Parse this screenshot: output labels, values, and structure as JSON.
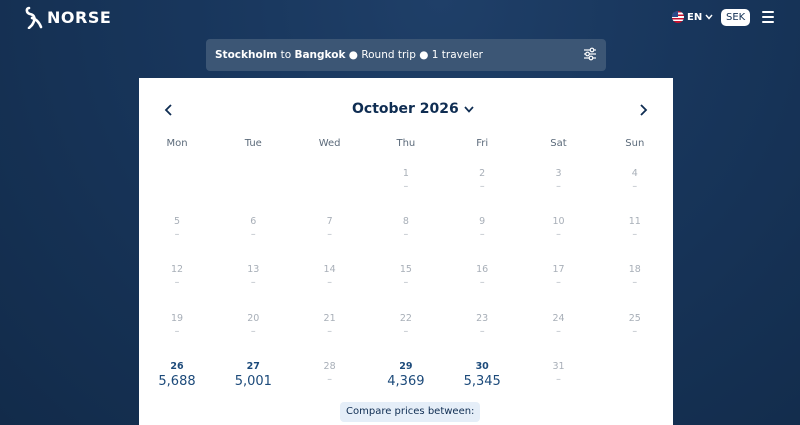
{
  "brand": {
    "name": "NORSE"
  },
  "header": {
    "language": "EN",
    "currency": "SEK"
  },
  "search": {
    "origin": "Stockholm",
    "to_word": "to",
    "destination": "Bangkok",
    "trip_type": "Round trip",
    "travelers": "1 traveler",
    "bullet": "●"
  },
  "calendar": {
    "month_label": "October 2026",
    "weekdays": [
      "Mon",
      "Tue",
      "Wed",
      "Thu",
      "Fri",
      "Sat",
      "Sun"
    ],
    "days": [
      {
        "d": "1",
        "price": "–"
      },
      {
        "d": "2",
        "price": "–"
      },
      {
        "d": "3",
        "price": "–"
      },
      {
        "d": "4",
        "price": "–"
      },
      {
        "d": "5",
        "price": "–"
      },
      {
        "d": "6",
        "price": "–"
      },
      {
        "d": "7",
        "price": "–"
      },
      {
        "d": "8",
        "price": "–"
      },
      {
        "d": "9",
        "price": "–"
      },
      {
        "d": "10",
        "price": "–"
      },
      {
        "d": "11",
        "price": "–"
      },
      {
        "d": "12",
        "price": "–"
      },
      {
        "d": "13",
        "price": "–"
      },
      {
        "d": "14",
        "price": "–"
      },
      {
        "d": "15",
        "price": "–"
      },
      {
        "d": "16",
        "price": "–"
      },
      {
        "d": "17",
        "price": "–"
      },
      {
        "d": "18",
        "price": "–"
      },
      {
        "d": "19",
        "price": "–"
      },
      {
        "d": "20",
        "price": "–"
      },
      {
        "d": "21",
        "price": "–"
      },
      {
        "d": "22",
        "price": "–"
      },
      {
        "d": "23",
        "price": "–"
      },
      {
        "d": "24",
        "price": "–"
      },
      {
        "d": "25",
        "price": "–"
      },
      {
        "d": "26",
        "price": "5,688",
        "available": true
      },
      {
        "d": "27",
        "price": "5,001",
        "available": true
      },
      {
        "d": "28",
        "price": "–"
      },
      {
        "d": "29",
        "price": "4,369",
        "available": true
      },
      {
        "d": "30",
        "price": "5,345",
        "available": true
      },
      {
        "d": "31",
        "price": "–"
      }
    ],
    "compare_label": "Compare prices between:"
  },
  "colors": {
    "brand_navy": "#0f2d52",
    "price_blue": "#1c4a7a",
    "searchbar_bg": "#3c5675"
  }
}
